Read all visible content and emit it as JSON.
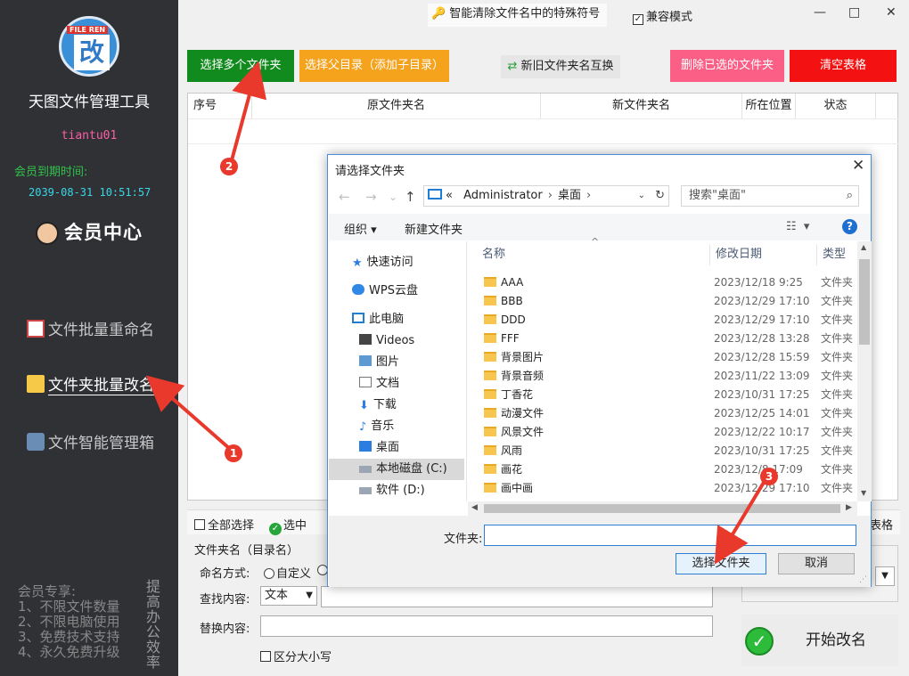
{
  "sidebar": {
    "logo_tag": "FILE REN",
    "logo_glyph": "改",
    "app_title": "天图文件管理工具",
    "username": "tiantu01",
    "expire_label": "会员到期时间:",
    "expire_value": "2039-08-31 10:51:57",
    "member_center": "会员中心",
    "nav": [
      {
        "label": "文件批量重命名",
        "icon": "document-icon"
      },
      {
        "label": "文件夹批量改名",
        "icon": "folder-icon",
        "active": true
      },
      {
        "label": "文件智能管理箱",
        "icon": "magnifier-icon"
      }
    ],
    "perks": [
      "会员专享:",
      "1、不限文件数量",
      "2、不限电脑使用",
      "3、免费技术支持",
      "4、永久免费升级"
    ],
    "vertical_text": "提高办公效率"
  },
  "topbar": {
    "feature": "智能清除文件名中的特殊符号",
    "compat_label": "兼容模式",
    "compat_checked": true,
    "minimize": "—",
    "maximize": "□",
    "close": "✕"
  },
  "actions": {
    "select_multi": "选择多个文件夹",
    "select_parent": "选择父目录（添加子目录）",
    "swap": "新旧文件夹名互换",
    "delete_selected": "删除已选的文件夹",
    "clear_table": "清空表格"
  },
  "table": {
    "headers": [
      "序号",
      "原文件夹名",
      "新文件夹名",
      "所在位置",
      "状态"
    ]
  },
  "bottom": {
    "select_all": "全部选择",
    "select": "选中",
    "table_tail": "表格",
    "group_title": "文件夹名（目录名）",
    "naming_label": "命名方式:",
    "naming_custom": "自定义",
    "find_label": "查找内容:",
    "find_type": "文本",
    "replace_label": "替换内容:",
    "case_label": "区分大小写",
    "start": "开始改名"
  },
  "dialog": {
    "title": "请选择文件夹",
    "path": [
      "«",
      "Administrator",
      "桌面"
    ],
    "search_placeholder": "搜索\"桌面\"",
    "organize": "组织",
    "new_folder": "新建文件夹",
    "tree": [
      {
        "label": "快速访问",
        "icon": "star-icon"
      },
      {
        "label": "WPS云盘",
        "icon": "cloud-icon"
      },
      {
        "label": "此电脑",
        "icon": "computer-icon"
      },
      {
        "label": "Videos",
        "icon": "video-icon"
      },
      {
        "label": "图片",
        "icon": "picture-icon"
      },
      {
        "label": "文档",
        "icon": "document-icon"
      },
      {
        "label": "下载",
        "icon": "download-icon"
      },
      {
        "label": "音乐",
        "icon": "music-icon"
      },
      {
        "label": "桌面",
        "icon": "desktop-icon"
      },
      {
        "label": "本地磁盘 (C:)",
        "icon": "drive-icon",
        "selected": true
      },
      {
        "label": "软件 (D:)",
        "icon": "drive-icon"
      }
    ],
    "columns": [
      "名称",
      "修改日期",
      "类型"
    ],
    "files": [
      {
        "name": "AAA",
        "date": "2023/12/18 9:25",
        "type": "文件夹"
      },
      {
        "name": "BBB",
        "date": "2023/12/29 17:10",
        "type": "文件夹"
      },
      {
        "name": "DDD",
        "date": "2023/12/29 17:10",
        "type": "文件夹"
      },
      {
        "name": "FFF",
        "date": "2023/12/28 13:28",
        "type": "文件夹"
      },
      {
        "name": "背景图片",
        "date": "2023/12/28 15:59",
        "type": "文件夹"
      },
      {
        "name": "背景音频",
        "date": "2023/11/22 13:09",
        "type": "文件夹"
      },
      {
        "name": "丁香花",
        "date": "2023/10/31 17:25",
        "type": "文件夹"
      },
      {
        "name": "动漫文件",
        "date": "2023/12/25 14:01",
        "type": "文件夹"
      },
      {
        "name": "风景文件",
        "date": "2023/12/22 10:17",
        "type": "文件夹"
      },
      {
        "name": "风雨",
        "date": "2023/10/31 17:25",
        "type": "文件夹"
      },
      {
        "name": "画花",
        "date": "2023/12/8 17:09",
        "type": "文件夹"
      },
      {
        "name": "画中画",
        "date": "2023/12/29 17:10",
        "type": "文件夹"
      }
    ],
    "filename_label": "文件夹:",
    "filename_value": "",
    "choose_btn": "选择文件夹",
    "cancel_btn": "取消"
  },
  "annotations": [
    "1",
    "2",
    "3"
  ],
  "colors": {
    "sidebar_bg": "#2f3135",
    "green_button": "#118a1e",
    "orange_button": "#f5a21c",
    "pink_button": "#fc5f86",
    "red_button": "#f41111",
    "annotation": "#e8392c"
  }
}
